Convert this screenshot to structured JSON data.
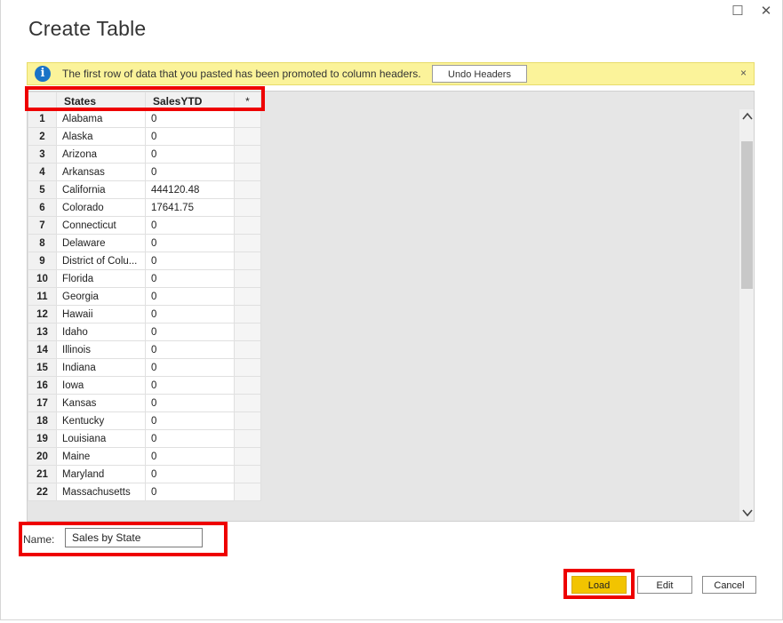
{
  "window": {
    "maximize_glyph": "☐",
    "close_glyph": "✕"
  },
  "dialog": {
    "title": "Create Table"
  },
  "banner": {
    "icon": "i",
    "message": "The first row of data that you pasted has been promoted to column headers.",
    "undo_label": "Undo Headers",
    "close_glyph": "×"
  },
  "table": {
    "columns": [
      "States",
      "SalesYTD",
      "*"
    ],
    "rows": [
      {
        "n": "1",
        "state": "Alabama",
        "sales": "0"
      },
      {
        "n": "2",
        "state": "Alaska",
        "sales": "0"
      },
      {
        "n": "3",
        "state": "Arizona",
        "sales": "0"
      },
      {
        "n": "4",
        "state": "Arkansas",
        "sales": "0"
      },
      {
        "n": "5",
        "state": "California",
        "sales": "444120.48"
      },
      {
        "n": "6",
        "state": "Colorado",
        "sales": "17641.75"
      },
      {
        "n": "7",
        "state": "Connecticut",
        "sales": "0"
      },
      {
        "n": "8",
        "state": "Delaware",
        "sales": "0"
      },
      {
        "n": "9",
        "state": "District of Colu...",
        "sales": "0"
      },
      {
        "n": "10",
        "state": "Florida",
        "sales": "0"
      },
      {
        "n": "11",
        "state": "Georgia",
        "sales": "0"
      },
      {
        "n": "12",
        "state": "Hawaii",
        "sales": "0"
      },
      {
        "n": "13",
        "state": "Idaho",
        "sales": "0"
      },
      {
        "n": "14",
        "state": "Illinois",
        "sales": "0"
      },
      {
        "n": "15",
        "state": "Indiana",
        "sales": "0"
      },
      {
        "n": "16",
        "state": "Iowa",
        "sales": "0"
      },
      {
        "n": "17",
        "state": "Kansas",
        "sales": "0"
      },
      {
        "n": "18",
        "state": "Kentucky",
        "sales": "0"
      },
      {
        "n": "19",
        "state": "Louisiana",
        "sales": "0"
      },
      {
        "n": "20",
        "state": "Maine",
        "sales": "0"
      },
      {
        "n": "21",
        "state": "Maryland",
        "sales": "0"
      },
      {
        "n": "22",
        "state": "Massachusetts",
        "sales": "0"
      }
    ]
  },
  "scrollbar": {
    "up_glyph": "^",
    "down_glyph": "v"
  },
  "name_field": {
    "label": "Name:",
    "value": "Sales by State"
  },
  "buttons": {
    "load": "Load",
    "edit": "Edit",
    "cancel": "Cancel"
  },
  "colors": {
    "highlight": "#ee0000",
    "load_button": "#f2c400",
    "banner": "#fbf39a",
    "info_icon": "#1a73c7"
  }
}
